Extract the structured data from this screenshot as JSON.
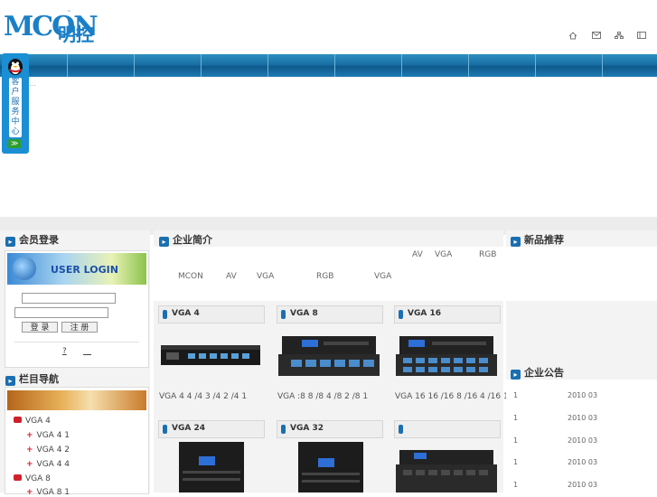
{
  "header": {
    "logo_latin": "MCON",
    "logo_cn": "明控",
    "logo_tm": "™",
    "icons": [
      "home-icon",
      "mail-icon",
      "sitemap-icon",
      "bookmark-icon"
    ]
  },
  "qq_widget": {
    "label": "客户服务中心",
    "arrow": "≫"
  },
  "stray_text": "...",
  "left": {
    "login_title": "会员登录",
    "login_banner": "USER LOGIN",
    "login_button": "登 录",
    "register_button": "注 册",
    "forgot_text": "?",
    "nav_title": "栏目导航",
    "nav_items": [
      {
        "label": "VGA    4",
        "level": 1
      },
      {
        "label": "VGA  4 1",
        "level": 2
      },
      {
        "label": "VGA  4 2",
        "level": 2
      },
      {
        "label": "VGA  4 4",
        "level": 2
      },
      {
        "label": "VGA    8",
        "level": 1
      },
      {
        "label": "VGA  8 1",
        "level": 2
      }
    ]
  },
  "center": {
    "intro_title": "企业简介",
    "intro_line1": [
      "AV",
      "VGA",
      "RGB"
    ],
    "intro_line2": [
      "MCON",
      "AV",
      "VGA",
      "RGB",
      "VGA"
    ],
    "products": [
      {
        "title": "VGA        4",
        "caption": "VGA     4 4 /4 3 /4 2 /4 1"
      },
      {
        "title": "VGA        8",
        "caption": "VGA     :8 8 /8 4 /8 2 /8 1"
      },
      {
        "title": "VGA        16",
        "caption": "VGA    16 16 /16 8 /16 4 /16 1"
      },
      {
        "title": "VGA        24",
        "caption": ""
      },
      {
        "title": "VGA        32",
        "caption": ""
      },
      {
        "title": "",
        "caption": ""
      }
    ]
  },
  "right": {
    "new_title": "新品推荐",
    "notice_title": "企业公告",
    "notices": [
      {
        "num": "1",
        "date": "2010 03"
      },
      {
        "num": "1",
        "date": "2010 03"
      },
      {
        "num": "1",
        "date": "2010 03"
      },
      {
        "num": "1",
        "date": "2010 03"
      },
      {
        "num": "1",
        "date": "2010 03"
      }
    ]
  },
  "colors": {
    "brand": "#1a7fc6",
    "nav_bar": "#1a6fa5",
    "accent_red": "#d0202a"
  }
}
